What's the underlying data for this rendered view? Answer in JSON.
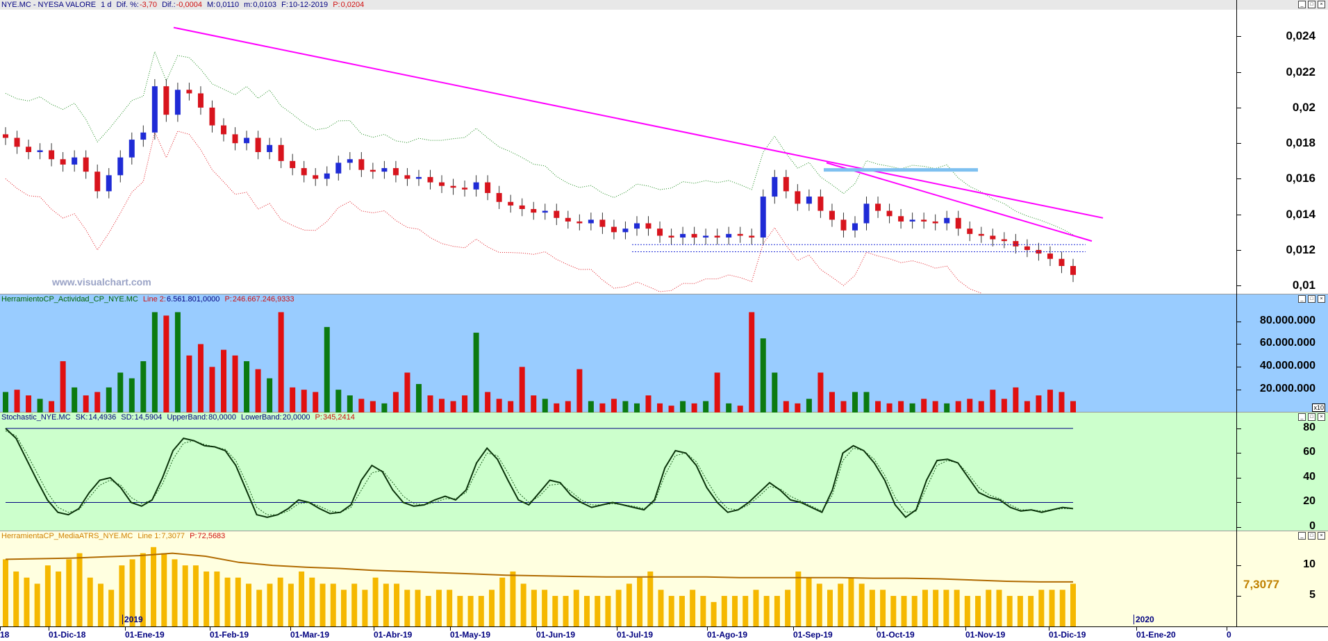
{
  "colors": {
    "up": "#1f2bd6",
    "down": "#d8141d",
    "magenta": "#ff00ff",
    "green_band": "#1a8a1a",
    "red_band": "#e0141d",
    "vol_bg": "#99ccff",
    "vol_green": "#0c7a10",
    "vol_red": "#e01010",
    "stoch_bg": "#ccffcc",
    "atr_bg": "#ffffe0",
    "atr_bar": "#f5b800",
    "atr_line": "#b06a00"
  },
  "panel1": {
    "symbol": "NYE.MC - NYESA VALORE",
    "period": "1 d",
    "dif_pct_label": "Dif. %:",
    "dif_pct": "-3,70",
    "dif_label": "Dif.:",
    "dif": "-0,0004",
    "max_label": "M:",
    "max": "0,0110",
    "min_label": "m:",
    "min": "0,0103",
    "date_label": "F:",
    "date": "10-12-2019",
    "price_label": "P:",
    "price": "0,0204",
    "watermark": "www.visualchart.com",
    "y_ticks": [
      "0,024",
      "0,022",
      "0,02",
      "0,018",
      "0,016",
      "0,014",
      "0,012",
      "0,01"
    ]
  },
  "panel2": {
    "name": "HerramientoCP_Actividad_CP_NYE.MC",
    "line_label": "Line 2:",
    "line_value": "6.561.801,0000",
    "p_label": "P:",
    "p_value": "246.667.246,9333",
    "y_ticks": [
      "80.000.000",
      "60.000.000",
      "40.000.000",
      "20.000.000"
    ],
    "scale_tag": "x10"
  },
  "panel3": {
    "name": "Stochastic_NYE.MC",
    "sk_label": "SK:",
    "sk": "14,4936",
    "sd_label": "SD:",
    "sd": "14,5904",
    "upper_label": "UpperBand:",
    "upper": "80,0000",
    "lower_label": "LowerBand:",
    "lower": "20,0000",
    "p_label": "P:",
    "p": "345,2414",
    "y_ticks": [
      "80",
      "60",
      "40",
      "20",
      "0"
    ]
  },
  "panel4": {
    "name": "HerramientaCP_MediaATRS_NYE.MC",
    "line_label": "Line 1:",
    "line_value": "7,3077",
    "p_label": "P:",
    "p_value": "72,5683",
    "y_ticks": [
      "10",
      "5"
    ],
    "current": "7,3077"
  },
  "x_axis": {
    "labels": [
      "18",
      "01-Dic-18",
      "01-Ene-19",
      "01-Feb-19",
      "01-Mar-19",
      "01-Abr-19",
      "01-May-19",
      "01-Jun-19",
      "01-Jul-19",
      "01-Ago-19",
      "01-Sep-19",
      "01-Oct-19",
      "01-Nov-19",
      "01-Dic-19",
      "01-Ene-20",
      "0"
    ],
    "year_markers": [
      "2019",
      "2020"
    ]
  },
  "chart_data": [
    {
      "type": "candlestick",
      "title": "NYE.MC - NYESA VALORE",
      "ylim": [
        0.0095,
        0.0255
      ],
      "series": [
        {
          "name": "Close",
          "values": [
            0.0183,
            0.0178,
            0.0175,
            0.0176,
            0.0171,
            0.0168,
            0.0172,
            0.0164,
            0.0153,
            0.0162,
            0.0172,
            0.0182,
            0.0186,
            0.0212,
            0.0196,
            0.021,
            0.0208,
            0.02,
            0.019,
            0.0185,
            0.018,
            0.0183,
            0.0175,
            0.0179,
            0.017,
            0.0166,
            0.0162,
            0.016,
            0.0163,
            0.0169,
            0.0171,
            0.0165,
            0.0164,
            0.0166,
            0.0162,
            0.016,
            0.0161,
            0.0158,
            0.0156,
            0.0155,
            0.0154,
            0.0158,
            0.0152,
            0.0147,
            0.0145,
            0.0143,
            0.0141,
            0.0142,
            0.0138,
            0.0136,
            0.0135,
            0.0137,
            0.0133,
            0.013,
            0.0132,
            0.0135,
            0.0132,
            0.0128,
            0.0127,
            0.0129,
            0.0127,
            0.0128,
            0.0127,
            0.0129,
            0.0128,
            0.0127,
            0.015,
            0.0161,
            0.0153,
            0.0146,
            0.015,
            0.0142,
            0.0137,
            0.0131,
            0.0135,
            0.0146,
            0.0142,
            0.0139,
            0.0136,
            0.0137,
            0.0136,
            0.0135,
            0.0138,
            0.0132,
            0.0129,
            0.0128,
            0.0126,
            0.0125,
            0.0122,
            0.012,
            0.0118,
            0.0115,
            0.0111,
            0.0106
          ]
        }
      ]
    },
    {
      "type": "bar",
      "title": "HerramientoCP_Actividad_CP_NYE.MC",
      "ylim": [
        0,
        95000000
      ],
      "series": [
        {
          "name": "Line 2",
          "values": [
            18000000,
            20000000,
            15000000,
            12000000,
            10000000,
            45000000,
            22000000,
            15000000,
            18000000,
            22000000,
            35000000,
            30000000,
            45000000,
            88000000,
            85000000,
            88000000,
            50000000,
            60000000,
            40000000,
            55000000,
            50000000,
            45000000,
            38000000,
            30000000,
            88000000,
            22000000,
            20000000,
            18000000,
            75000000,
            20000000,
            15000000,
            12000000,
            10000000,
            8000000,
            18000000,
            35000000,
            25000000,
            15000000,
            12000000,
            10000000,
            15000000,
            70000000,
            18000000,
            12000000,
            10000000,
            40000000,
            15000000,
            12000000,
            8000000,
            10000000,
            38000000,
            10000000,
            8000000,
            12000000,
            10000000,
            8000000,
            15000000,
            8000000,
            6000000,
            10000000,
            8000000,
            10000000,
            35000000,
            8000000,
            6000000,
            88000000,
            65000000,
            35000000,
            10000000,
            8000000,
            12000000,
            35000000,
            18000000,
            10000000,
            18000000,
            18000000,
            10000000,
            8000000,
            10000000,
            8000000,
            12000000,
            10000000,
            8000000,
            10000000,
            12000000,
            10000000,
            20000000,
            12000000,
            22000000,
            10000000,
            15000000,
            20000000,
            18000000,
            10000000
          ]
        }
      ]
    },
    {
      "type": "line",
      "title": "Stochastic_NYE.MC",
      "ylim": [
        0,
        85
      ],
      "upper_band": 80,
      "lower_band": 20,
      "series": [
        {
          "name": "SK",
          "values": [
            80,
            72,
            55,
            38,
            22,
            12,
            10,
            15,
            28,
            38,
            40,
            32,
            20,
            17,
            22,
            40,
            62,
            72,
            70,
            66,
            65,
            62,
            50,
            30,
            10,
            8,
            10,
            15,
            22,
            20,
            15,
            11,
            12,
            18,
            38,
            50,
            45,
            30,
            20,
            17,
            18,
            22,
            25,
            22,
            30,
            52,
            64,
            55,
            38,
            22,
            18,
            28,
            38,
            36,
            26,
            20,
            16,
            18,
            20,
            18,
            16,
            14,
            22,
            48,
            62,
            60,
            50,
            32,
            20,
            12,
            14,
            20,
            28,
            36,
            30,
            22,
            20,
            16,
            12,
            30,
            60,
            66,
            62,
            52,
            38,
            18,
            8,
            14,
            38,
            54,
            55,
            52,
            40,
            28,
            24,
            22,
            16,
            13,
            14,
            12,
            14,
            16,
            15
          ]
        },
        {
          "name": "SD",
          "values": [
            78,
            74,
            60,
            44,
            28,
            16,
            12,
            14,
            24,
            34,
            38,
            34,
            24,
            19,
            22,
            35,
            55,
            68,
            70,
            67,
            65,
            63,
            54,
            36,
            16,
            10,
            10,
            13,
            19,
            20,
            17,
            13,
            12,
            16,
            30,
            44,
            46,
            36,
            25,
            19,
            18,
            20,
            23,
            23,
            28,
            45,
            60,
            58,
            44,
            28,
            20,
            25,
            34,
            35,
            29,
            22,
            18,
            18,
            19,
            18,
            17,
            15,
            20,
            42,
            58,
            60,
            53,
            38,
            24,
            15,
            14,
            18,
            25,
            33,
            31,
            25,
            21,
            17,
            13,
            26,
            54,
            64,
            62,
            55,
            42,
            24,
            12,
            13,
            32,
            50,
            54,
            52,
            43,
            32,
            26,
            23,
            18,
            14,
            14,
            13,
            14,
            15,
            15
          ]
        }
      ]
    },
    {
      "type": "bar",
      "title": "HerramientaCP_MediaATRS_NYE.MC",
      "ylim": [
        0,
        14
      ],
      "series": [
        {
          "name": "ATR",
          "values": [
            11,
            9,
            8,
            7,
            10,
            9,
            11,
            12,
            8,
            7,
            6,
            10,
            11,
            12,
            13,
            12,
            11,
            10,
            10,
            9,
            9,
            8,
            8,
            7,
            6,
            7,
            8,
            7,
            9,
            8,
            7,
            7,
            6,
            7,
            6,
            8,
            7,
            7,
            6,
            6,
            5,
            6,
            6,
            5,
            5,
            5,
            6,
            8,
            9,
            7,
            6,
            6,
            5,
            5,
            6,
            5,
            5,
            5,
            6,
            7,
            8,
            9,
            6,
            5,
            5,
            6,
            5,
            4,
            5,
            5,
            5,
            6,
            5,
            5,
            6,
            9,
            8,
            7,
            6,
            7,
            8,
            7,
            6,
            6,
            5,
            5,
            5,
            6,
            6,
            6,
            6,
            5,
            5,
            6,
            6,
            5,
            5,
            5,
            6,
            6,
            6,
            7
          ]
        },
        {
          "name": "Line 1",
          "values": [
            11,
            11.1,
            11.2,
            11.4,
            11.6,
            12,
            11.5,
            10.5,
            10,
            9.7,
            9.5,
            9.2,
            9,
            8.8,
            8.6,
            8.4,
            8.3,
            8.2,
            8.1,
            8.1,
            8.1,
            8.1,
            8.0,
            8.0,
            8.0,
            8.0,
            7.9,
            7.9,
            7.8,
            7.6,
            7.4,
            7.3,
            7.3
          ]
        }
      ]
    }
  ]
}
